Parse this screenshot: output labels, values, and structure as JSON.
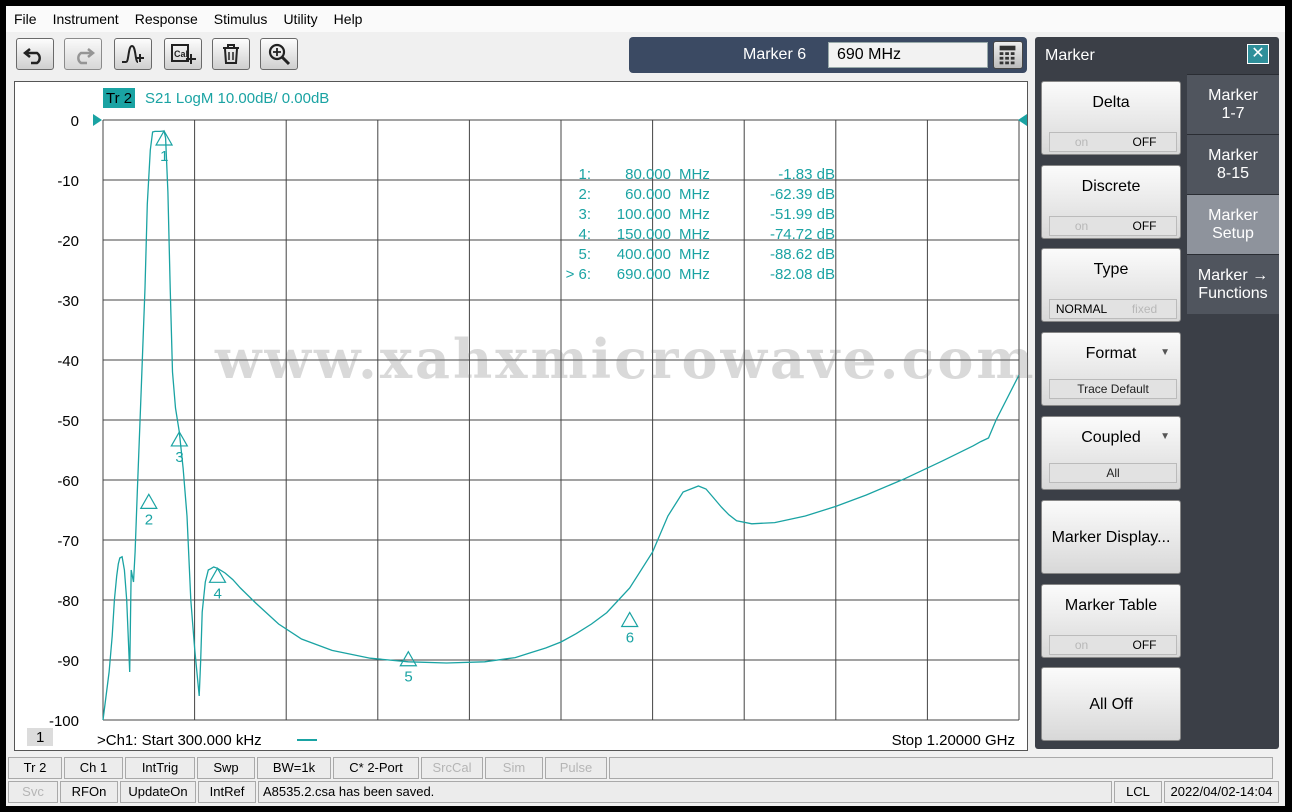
{
  "menu": [
    "File",
    "Instrument",
    "Response",
    "Stimulus",
    "Utility",
    "Help"
  ],
  "toolbar": {
    "icons": [
      "undo-icon",
      "redo-icon",
      "marker-add-icon",
      "cal-add-icon",
      "trash-icon",
      "zoom-icon"
    ]
  },
  "marker_entry": {
    "label": "Marker 6",
    "value": "690 MHz"
  },
  "trace": {
    "tag": "Tr 2",
    "desc": "S21 LogM 10.00dB/  0.00dB"
  },
  "channel": {
    "badge": "1",
    "start": ">Ch1:  Start  300.000 kHz",
    "stop": "Stop  1.20000 GHz"
  },
  "watermark": "www.xahxmicrowave.com",
  "colors": {
    "trace": "#1aa3a3",
    "grid": "#444444",
    "panel": "#3b3f47",
    "tab_active": "#8e939c"
  },
  "chart_data": {
    "type": "line",
    "xlim": [
      0.0003,
      1200
    ],
    "ylim": [
      -100,
      0
    ],
    "x_unit": "MHz",
    "yticks": [
      "0",
      "-10",
      "-20",
      "-30",
      "-40",
      "-50",
      "-60",
      "-70",
      "-80",
      "-90",
      "-100"
    ],
    "grid": true,
    "series": [
      {
        "x": [
          0.0003,
          8,
          12,
          15,
          18,
          20,
          22,
          25,
          28,
          31,
          35,
          37,
          40,
          42,
          45,
          48,
          50,
          55,
          58,
          62,
          65,
          68,
          72,
          75,
          78,
          80,
          82,
          85,
          88,
          91,
          95,
          100,
          105,
          110,
          115,
          120,
          126,
          128,
          130,
          134,
          136,
          138,
          141,
          145,
          150,
          160,
          170,
          180,
          200,
          230,
          260,
          300,
          350,
          400,
          450,
          500,
          540,
          560,
          580,
          600,
          620,
          640,
          660,
          690,
          720,
          740,
          760,
          780,
          790,
          800,
          810,
          820,
          830,
          850,
          880,
          920,
          960,
          1000,
          1050,
          1100,
          1140,
          1150,
          1160,
          1170,
          1200
        ],
        "y": [
          -100,
          -92,
          -86,
          -80,
          -76,
          -74,
          -73,
          -72.8,
          -75,
          -80,
          -92,
          -75,
          -77,
          -72,
          -62,
          -52,
          -45,
          -28,
          -14,
          -5,
          -2,
          -1.9,
          -1.9,
          -1.9,
          -1.85,
          -1.83,
          -3,
          -12,
          -28,
          -42,
          -48,
          -51.99,
          -58,
          -66,
          -80,
          -88,
          -96,
          -90,
          -82,
          -77,
          -76,
          -75,
          -74.8,
          -74.5,
          -74.72,
          -75.5,
          -76.6,
          -78,
          -80.5,
          -84,
          -86.5,
          -88.4,
          -89.7,
          -90.3,
          -90.5,
          -90.3,
          -89.6,
          -88.8,
          -88,
          -87,
          -85.6,
          -84,
          -82.1,
          -78,
          -72,
          -66,
          -62,
          -61,
          -61.5,
          -63,
          -64.5,
          -65.8,
          -66.8,
          -67.3,
          -67.1,
          -66,
          -64.4,
          -62.5,
          -59.8,
          -56.8,
          -54.3,
          -53.6,
          -53,
          -50,
          -42.5
        ]
      }
    ],
    "markers": [
      {
        "id": "1",
        "x": 80,
        "y": -1.83
      },
      {
        "id": "2",
        "x": 60,
        "y": -62.39
      },
      {
        "id": "3",
        "x": 100,
        "y": -51.99
      },
      {
        "id": "4",
        "x": 150,
        "y": -74.72
      },
      {
        "id": "5",
        "x": 400,
        "y": -88.62
      },
      {
        "id": "6",
        "x": 690,
        "y": -82.08
      }
    ],
    "marker_table": [
      {
        "n": "1:",
        "f": "80.000",
        "u": "MHz",
        "v": "-1.83 dB"
      },
      {
        "n": "2:",
        "f": "60.000",
        "u": "MHz",
        "v": "-62.39 dB"
      },
      {
        "n": "3:",
        "f": "100.000",
        "u": "MHz",
        "v": "-51.99 dB"
      },
      {
        "n": "4:",
        "f": "150.000",
        "u": "MHz",
        "v": "-74.72 dB"
      },
      {
        "n": "5:",
        "f": "400.000",
        "u": "MHz",
        "v": "-88.62 dB"
      },
      {
        "n": "> 6:",
        "f": "690.000",
        "u": "MHz",
        "v": "-82.08 dB"
      }
    ]
  },
  "panel": {
    "title": "Marker",
    "softkeys": [
      {
        "label": "Delta",
        "left": "on",
        "right": "OFF"
      },
      {
        "label": "Discrete",
        "left": "on",
        "right": "OFF"
      },
      {
        "label": "Type",
        "left": "NORMAL",
        "right": "fixed"
      },
      {
        "label": "Format",
        "value": "Trace Default"
      },
      {
        "label": "Coupled",
        "value": "All"
      },
      {
        "label": "Marker Display..."
      },
      {
        "label": "Marker Table",
        "left": "on",
        "right": "OFF"
      },
      {
        "label": "All Off"
      }
    ],
    "tabs": [
      {
        "l1": "Marker",
        "l2": "1-7"
      },
      {
        "l1": "Marker",
        "l2": "8-15"
      },
      {
        "l1": "Marker",
        "l2": "Setup"
      },
      {
        "l1": "Marker →",
        "l2": "Functions"
      }
    ]
  },
  "status1": [
    {
      "t": "Tr 2",
      "dis": false
    },
    {
      "t": "Ch 1",
      "dis": false
    },
    {
      "t": "IntTrig",
      "dis": false
    },
    {
      "t": "Swp",
      "dis": false
    },
    {
      "t": "BW=1k",
      "dis": false
    },
    {
      "t": "C* 2-Port",
      "dis": false
    },
    {
      "t": "SrcCal",
      "dis": true
    },
    {
      "t": "Sim",
      "dis": true
    },
    {
      "t": "Pulse",
      "dis": true
    }
  ],
  "status2": {
    "cells": [
      {
        "t": "Svc",
        "dis": true
      },
      {
        "t": "RFOn",
        "dis": false
      },
      {
        "t": "UpdateOn",
        "dis": false
      },
      {
        "t": "IntRef",
        "dis": false
      }
    ],
    "message": "A8535.2.csa has been saved.",
    "lcl": "LCL",
    "time": "2022/04/02-14:04"
  }
}
